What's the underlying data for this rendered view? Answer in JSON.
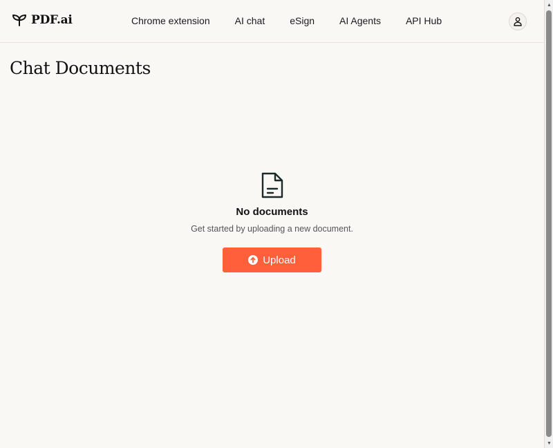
{
  "header": {
    "logo_text": "PDF.ai",
    "logo_icon": "sprout-icon",
    "nav": [
      {
        "label": "Chrome extension"
      },
      {
        "label": "AI chat"
      },
      {
        "label": "eSign"
      },
      {
        "label": "AI Agents"
      },
      {
        "label": "API Hub"
      }
    ],
    "account_icon": "user-icon"
  },
  "main": {
    "title": "Chat Documents",
    "empty_state": {
      "icon": "document-icon",
      "title": "No documents",
      "subtitle": "Get started by uploading a new document.",
      "upload_label": "Upload",
      "upload_icon": "arrow-up-circle-icon"
    }
  },
  "colors": {
    "background": "#faf8f4",
    "accent": "#ff5f3a",
    "text": "#111111"
  }
}
